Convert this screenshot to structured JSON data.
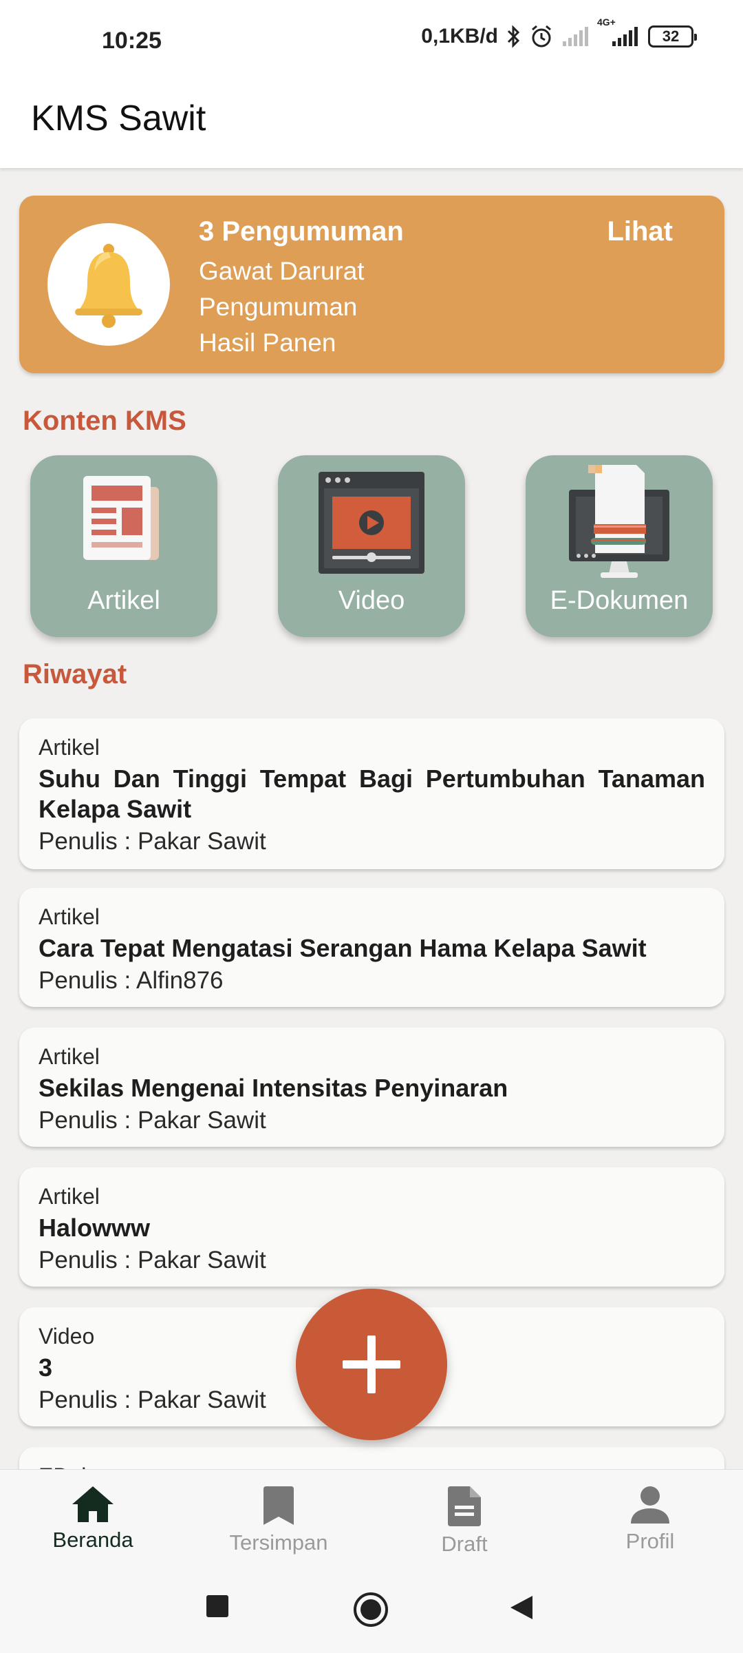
{
  "status_bar": {
    "time": "10:25",
    "network_speed": "0,1KB/d",
    "network_type": "4G+",
    "battery": "32",
    "icons": [
      "bluetooth-icon",
      "alarm-icon",
      "signal-icon",
      "signal-4g-icon"
    ]
  },
  "app_bar": {
    "title": "KMS Sawit"
  },
  "announcement": {
    "count_label": "3 Pengumuman",
    "categories": [
      "Gawat Darurat",
      "Pengumuman",
      "Hasil Panen"
    ],
    "link_label": "Lihat",
    "icon": "bell-icon",
    "bg_color": "#df9e55"
  },
  "kms_content": {
    "title": "Konten KMS",
    "tiles": [
      {
        "label": "Artikel",
        "icon": "newspaper-icon"
      },
      {
        "label": "Video",
        "icon": "video-player-icon"
      },
      {
        "label": "E-Dokumen",
        "icon": "document-monitor-icon"
      }
    ]
  },
  "history": {
    "title": "Riwayat",
    "items": [
      {
        "type": "Artikel",
        "title": "Suhu Dan Tinggi Tempat Bagi Pertumbuhan Tanaman Kelapa Sawit",
        "author": "Penulis : Pakar Sawit"
      },
      {
        "type": "Artikel",
        "title": "Cara Tepat Mengatasi Serangan Hama Kelapa Sawit",
        "author": "Penulis : Alfin876"
      },
      {
        "type": "Artikel",
        "title": "Sekilas Mengenai Intensitas Penyinaran",
        "author": "Penulis : Pakar Sawit"
      },
      {
        "type": "Artikel",
        "title": "Halowww",
        "author": "Penulis : Pakar Sawit"
      },
      {
        "type": "Video",
        "title": "3",
        "author": "Penulis : Pakar Sawit"
      },
      {
        "type": "EDok",
        "title": "",
        "author": ""
      }
    ]
  },
  "fab": {
    "icon": "plus-icon",
    "color": "#c85a38"
  },
  "bottom_nav": {
    "items": [
      {
        "label": "Beranda",
        "icon": "home-icon",
        "active": true
      },
      {
        "label": "Tersimpan",
        "icon": "bookmark-icon",
        "active": false
      },
      {
        "label": "Draft",
        "icon": "document-icon",
        "active": false
      },
      {
        "label": "Profil",
        "icon": "person-icon",
        "active": false
      }
    ]
  },
  "system_nav": {
    "icons": [
      "recents-square-icon",
      "home-circle-icon",
      "back-triangle-icon"
    ]
  },
  "colors": {
    "accent": "#c8583b",
    "tile": "#96b0a4",
    "background": "#f1f0ef"
  }
}
